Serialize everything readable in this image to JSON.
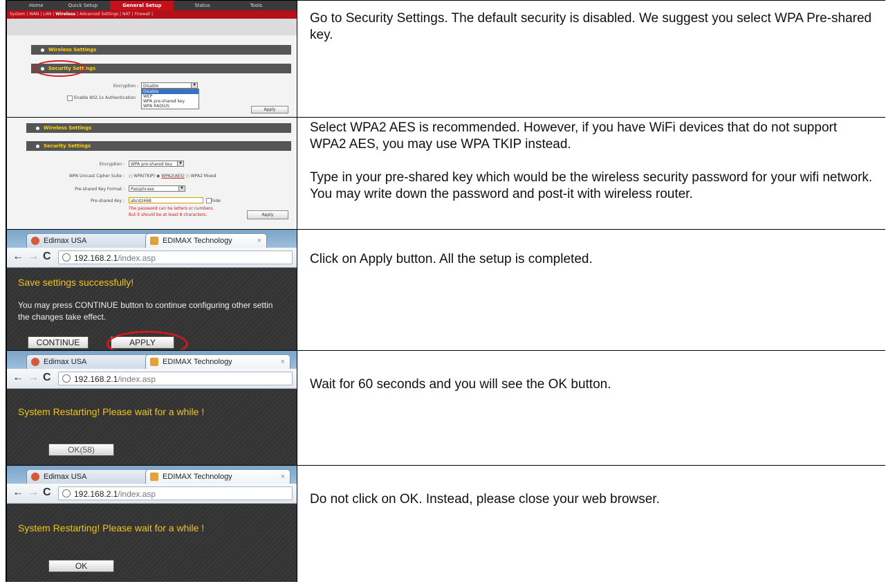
{
  "rows": [
    {
      "instruction": [
        "Go to Security Settings.  The default security is disabled.  We suggest you select WPA Pre-shared key."
      ],
      "screenshot": {
        "nav": [
          "Home",
          "Quick Setup",
          "General Setup",
          "Status",
          "Tools"
        ],
        "nav_active": "General Setup",
        "subnav_prefix": "System | WAN | LAN | ",
        "subnav_active": "Wireless",
        "subnav_suffix": " | Advanced Settings | NAT | Firewall |",
        "wireless_band": "Wireless Settings",
        "security_band": "Security Settings",
        "encryption_label": "Encryption :",
        "encryption_value": "Disable",
        "options": [
          "Disable",
          "WEP",
          "WPA pre-shared key",
          "WPA RADIUS"
        ],
        "enable_8021x": "Enable 802.1x Authentication",
        "apply": "Apply"
      }
    },
    {
      "instruction": [
        "Select WPA2 AES is recommended.  However, if you have WiFi devices that do not support WPA2 AES, you may use WPA TKIP instead.",
        "Type in your pre-shared key which would be the wireless security password for your wifi network.  You may write down the password and post-it with wireless router."
      ],
      "screenshot": {
        "wireless_band": "Wireless Settings",
        "security_band": "Security Settings",
        "encryption_label": "Encryption :",
        "encryption_value": "WPA pre-shared key",
        "cipher_label": "WPA Unicast Cipher Suite :",
        "cipher_options": [
          "WPA(TKIP)",
          "WPA2(AES)",
          "WPA2 Mixed"
        ],
        "format_label": "Pre-shared Key Format :",
        "format_value": "Passphrase",
        "key_label": "Pre-shared Key :",
        "key_value": "abcd2468",
        "hide": "hide",
        "note1": "The password can be letters or numbers.",
        "note2": "But it should be at least 8 characters.",
        "apply": "Apply"
      }
    },
    {
      "instruction": [
        "Click on Apply button.  All the setup is completed."
      ],
      "screenshot": {
        "tab1": "Edimax USA",
        "tab2": "EDIMAX Technology",
        "url_host": "192.168.2.1",
        "url_path": "/index.asp",
        "message": "Save settings successfully!",
        "sub1": "You may press CONTINUE button to continue configuring other settin",
        "sub2": "the changes take effect.",
        "continue": "CONTINUE",
        "apply": "APPLY"
      }
    },
    {
      "instruction": [
        "Wait for 60 seconds and you will see the OK button."
      ],
      "screenshot": {
        "tab1": "Edimax USA",
        "tab2": "EDIMAX Technology",
        "url_host": "192.168.2.1",
        "url_path": "/index.asp",
        "message": "System Restarting! Please wait for a while !",
        "button": "OK(58)"
      }
    },
    {
      "instruction": [
        "Do not click on OK.  Instead, please close your web browser."
      ],
      "screenshot": {
        "tab1": "Edimax USA",
        "tab2": "EDIMAX Technology",
        "url_host": "192.168.2.1",
        "url_path": "/index.asp",
        "message": "System Restarting! Please wait for a while !",
        "button": "OK"
      }
    }
  ],
  "colors": {
    "accent_red": "#c6111b",
    "message_yellow": "#f0c419",
    "ring_red": "#d21a1a"
  }
}
